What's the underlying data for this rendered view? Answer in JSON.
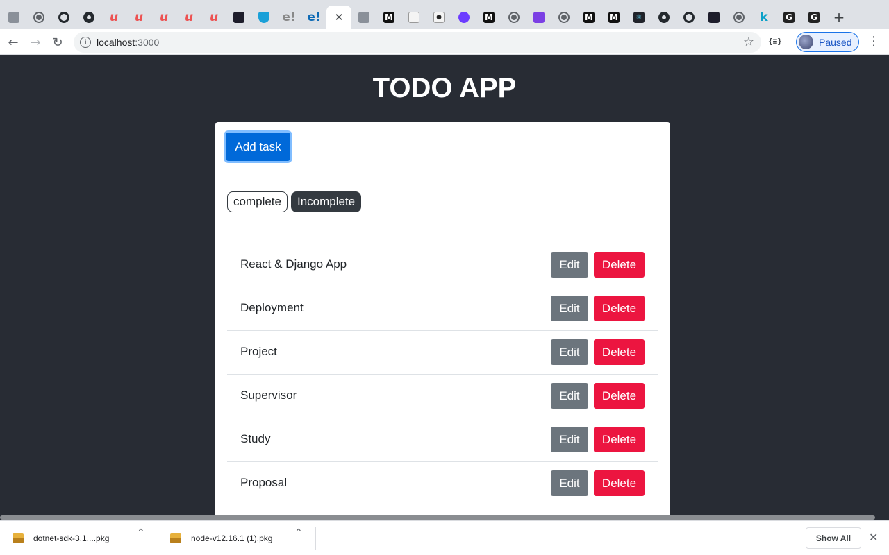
{
  "browser": {
    "tabs": [
      {
        "icon": "profile-shield-icon",
        "fav": "grey",
        "glyph": ""
      },
      {
        "icon": "globe-icon",
        "fav": "globe",
        "glyph": ""
      },
      {
        "icon": "spiral-icon",
        "fav": "ring",
        "glyph": ""
      },
      {
        "icon": "github-icon",
        "fav": "gh",
        "glyph": ""
      },
      {
        "icon": "udemy-icon",
        "fav": "udemy",
        "glyph": "u"
      },
      {
        "icon": "udemy-icon",
        "fav": "udemy",
        "glyph": "u"
      },
      {
        "icon": "udemy-icon",
        "fav": "udemy",
        "glyph": "u"
      },
      {
        "icon": "udemy-icon",
        "fav": "udemy",
        "glyph": "u"
      },
      {
        "icon": "udemy-icon",
        "fav": "udemy",
        "glyph": "u"
      },
      {
        "icon": "aws-icon",
        "fav": "dark",
        "glyph": ""
      },
      {
        "icon": "shield-icon",
        "fav": "shield",
        "glyph": ""
      },
      {
        "icon": "e-logo-icon",
        "fav": "elog",
        "glyph": "e!"
      },
      {
        "icon": "e-logo-icon",
        "fav": "eblue",
        "glyph": "e!"
      },
      {
        "icon": "close-tab-icon",
        "fav": "x",
        "glyph": "✕",
        "active": true
      },
      {
        "icon": "image-icon",
        "fav": "grey",
        "glyph": ""
      },
      {
        "icon": "medium-icon",
        "fav": "med",
        "glyph": "M"
      },
      {
        "icon": "notebook-icon",
        "fav": "note",
        "glyph": ""
      },
      {
        "icon": "dot-icon",
        "fav": "note",
        "glyph": "●"
      },
      {
        "icon": "duo-icon",
        "fav": "duo",
        "glyph": ""
      },
      {
        "icon": "medium-icon",
        "fav": "med",
        "glyph": "M"
      },
      {
        "icon": "globe-icon",
        "fav": "globe",
        "glyph": ""
      },
      {
        "icon": "rocket-icon",
        "fav": "purple",
        "glyph": ""
      },
      {
        "icon": "globe-icon",
        "fav": "globe",
        "glyph": ""
      },
      {
        "icon": "medium-icon",
        "fav": "med",
        "glyph": "M"
      },
      {
        "icon": "medium-icon",
        "fav": "med",
        "glyph": "M"
      },
      {
        "icon": "react-icon",
        "fav": "react",
        "glyph": "⚛"
      },
      {
        "icon": "github-icon",
        "fav": "gh",
        "glyph": ""
      },
      {
        "icon": "ring-icon",
        "fav": "ring",
        "glyph": ""
      },
      {
        "icon": "bird-icon",
        "fav": "dark",
        "glyph": ""
      },
      {
        "icon": "globe-icon",
        "fav": "globe",
        "glyph": ""
      },
      {
        "icon": "k-icon",
        "fav": "k",
        "glyph": "k"
      },
      {
        "icon": "g-logo-icon",
        "fav": "gl",
        "glyph": "G"
      },
      {
        "icon": "g-logo-icon",
        "fav": "gl",
        "glyph": "G"
      },
      {
        "icon": "new-tab-icon",
        "fav": "plus",
        "glyph": "+"
      }
    ],
    "nav": {
      "back": "←",
      "forward": "→",
      "reload": "↻"
    },
    "url_host": "localhost",
    "url_port": ":3000",
    "extension_label": "{≡}",
    "profile_label": "Paused",
    "menu": "⋮"
  },
  "page": {
    "title": "TODO APP",
    "add_button": "Add task",
    "filters": {
      "complete": "complete",
      "incomplete": "Incomplete"
    },
    "tasks": [
      {
        "title": "React & Django App"
      },
      {
        "title": "Deployment"
      },
      {
        "title": "Project"
      },
      {
        "title": "Supervisor"
      },
      {
        "title": "Study"
      },
      {
        "title": "Proposal"
      }
    ],
    "edit_label": "Edit",
    "delete_label": "Delete"
  },
  "downloads": {
    "items": [
      {
        "name": "dotnet-sdk-3.1....pkg"
      },
      {
        "name": "node-v12.16.1 (1).pkg"
      }
    ],
    "show_all": "Show All",
    "close": "✕"
  },
  "colors": {
    "page_bg": "#282c34",
    "primary": "#0069d9",
    "secondary": "#6c757d",
    "danger": "#ec1540",
    "dark": "#343a40"
  }
}
